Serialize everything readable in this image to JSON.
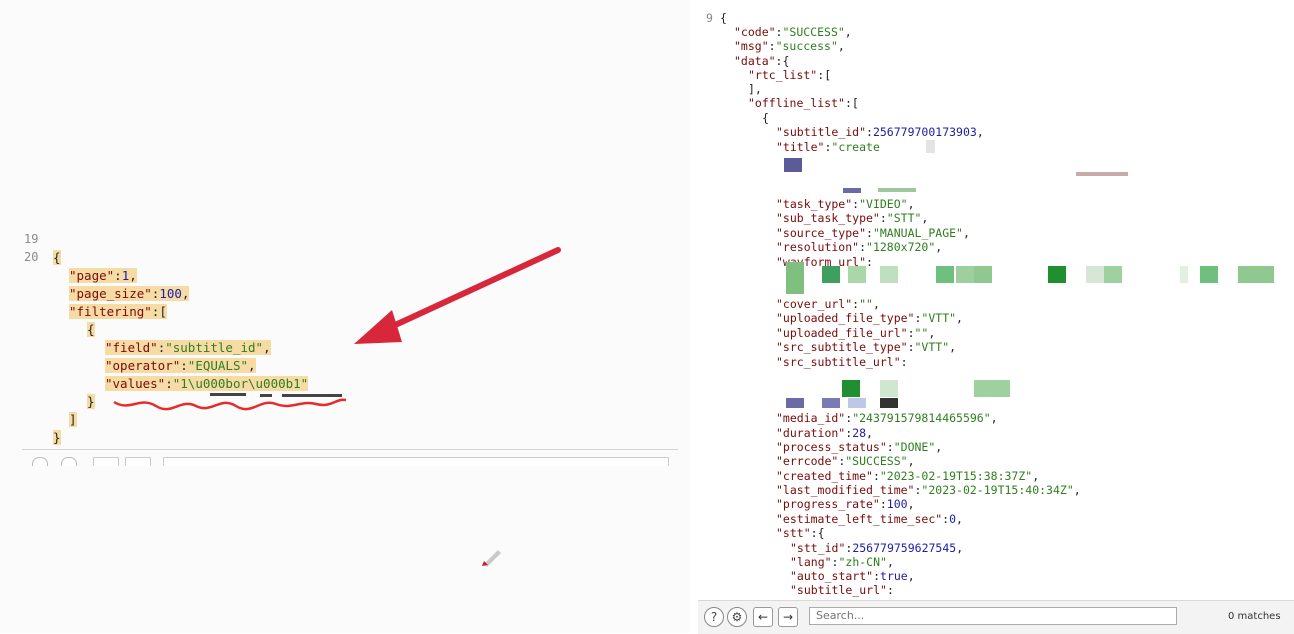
{
  "left_editor": {
    "gutter": [
      "19",
      "20"
    ],
    "lines": [
      [
        "{"
      ],
      [
        "\"page\"",
        ":",
        "1",
        ","
      ],
      [
        "\"page_size\"",
        ":",
        "100",
        ","
      ],
      [
        "\"filtering\"",
        ":["
      ],
      [
        "{"
      ],
      [
        "\"field\"",
        ":",
        "\"subtitle_id\"",
        ","
      ],
      [
        "\"operator\"",
        ":",
        "\"EQUALS\"",
        ","
      ],
      [
        "\"values\"",
        ":",
        "\"1\\u000bor\\u000b1\""
      ],
      [
        "}"
      ],
      [
        "]"
      ],
      [
        "}"
      ]
    ]
  },
  "right_viewer": {
    "gutter": "9",
    "lines": [
      {
        "t": "{"
      },
      {
        "k": "\"code\"",
        "v": "\"SUCCESS\"",
        "vt": "s",
        "c": ","
      },
      {
        "k": "\"msg\"",
        "v": "\"success\"",
        "vt": "s",
        "c": ","
      },
      {
        "k": "\"data\"",
        "v": "{",
        "vt": "p"
      },
      {
        "k": "\"rtc_list\"",
        "v": "[",
        "vt": "p"
      },
      {
        "t": "],"
      },
      {
        "k": "\"offline_list\"",
        "v": "[",
        "vt": "p"
      },
      {
        "t": "{"
      },
      {
        "k": "\"subtitle_id\"",
        "v": "256779700173903",
        "vt": "n",
        "c": ","
      },
      {
        "k": "\"title\"",
        "v": "\"create",
        "vt": "s"
      },
      {
        "k": "\"task_type\"",
        "v": "\"VIDEO\"",
        "vt": "s",
        "c": ","
      },
      {
        "k": "\"sub_task_type\"",
        "v": "\"STT\"",
        "vt": "s",
        "c": ","
      },
      {
        "k": "\"source_type\"",
        "v": "\"MANUAL_PAGE\"",
        "vt": "s",
        "c": ","
      },
      {
        "k": "\"resolution\"",
        "v": "\"1280x720\"",
        "vt": "s",
        "c": ","
      },
      {
        "k": "\"wavform_url\"",
        "v": "",
        "vt": "p"
      },
      {
        "k": "\"cover_url\"",
        "v": "\"\"",
        "vt": "s",
        "c": ","
      },
      {
        "k": "\"uploaded_file_type\"",
        "v": "\"VTT\"",
        "vt": "s",
        "c": ","
      },
      {
        "k": "\"uploaded_file_url\"",
        "v": "\"\"",
        "vt": "s",
        "c": ","
      },
      {
        "k": "\"src_subtitle_type\"",
        "v": "\"VTT\"",
        "vt": "s",
        "c": ","
      },
      {
        "k": "\"src_subtitle_url\"",
        "v": "",
        "vt": "p"
      },
      {
        "k": "\"media_id\"",
        "v": "\"243791579814465596\"",
        "vt": "s",
        "c": ","
      },
      {
        "k": "\"duration\"",
        "v": "28",
        "vt": "n",
        "c": ","
      },
      {
        "k": "\"process_status\"",
        "v": "\"DONE\"",
        "vt": "s",
        "c": ","
      },
      {
        "k": "\"errcode\"",
        "v": "\"SUCCESS\"",
        "vt": "s",
        "c": ","
      },
      {
        "k": "\"created_time\"",
        "v": "\"2023-02-19T15:38:37Z\"",
        "vt": "s",
        "c": ","
      },
      {
        "k": "\"last_modified_time\"",
        "v": "\"2023-02-19T15:40:34Z\"",
        "vt": "s",
        "c": ","
      },
      {
        "k": "\"progress_rate\"",
        "v": "100",
        "vt": "n",
        "c": ","
      },
      {
        "k": "\"estimate_left_time_sec\"",
        "v": "0",
        "vt": "n",
        "c": ","
      },
      {
        "k": "\"stt\"",
        "v": "{",
        "vt": "p"
      },
      {
        "k": "\"stt_id\"",
        "v": "256779759627545",
        "vt": "n",
        "c": ","
      },
      {
        "k": "\"lang\"",
        "v": "\"zh-CN\"",
        "vt": "s",
        "c": ","
      },
      {
        "k": "\"auto_start\"",
        "v": "true",
        "vt": "n",
        "c": ","
      },
      {
        "k": "\"subtitle_url\"",
        "v": "",
        "vt": "p"
      }
    ]
  },
  "toolbar": {
    "help_icon": "?",
    "settings_icon": "⚙",
    "prev_icon": "←",
    "next_icon": "→",
    "search_placeholder": "Search...",
    "matches": "0 matches"
  },
  "colors": {
    "highlight": "#f6dca4",
    "key": "#7a0a0a",
    "string": "#2f7e1f",
    "number": "#1c1ca8",
    "arrow": "#d8263a"
  }
}
